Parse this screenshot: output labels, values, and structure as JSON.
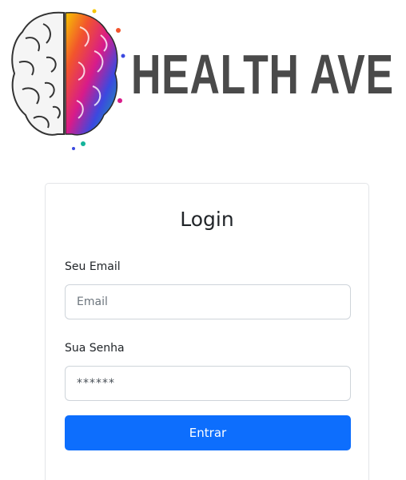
{
  "brand": {
    "name": "HEALTH AVE"
  },
  "login": {
    "title": "Login",
    "email_label": "Seu Email",
    "email_placeholder": "Email",
    "email_value": "",
    "password_label": "Sua Senha",
    "password_value": "******",
    "submit_label": "Entrar"
  },
  "colors": {
    "primary": "#0d6efd",
    "brand_text": "#4a4a4a",
    "card_border": "#e3e5e8"
  },
  "icons": {
    "logo": "brain-icon"
  }
}
